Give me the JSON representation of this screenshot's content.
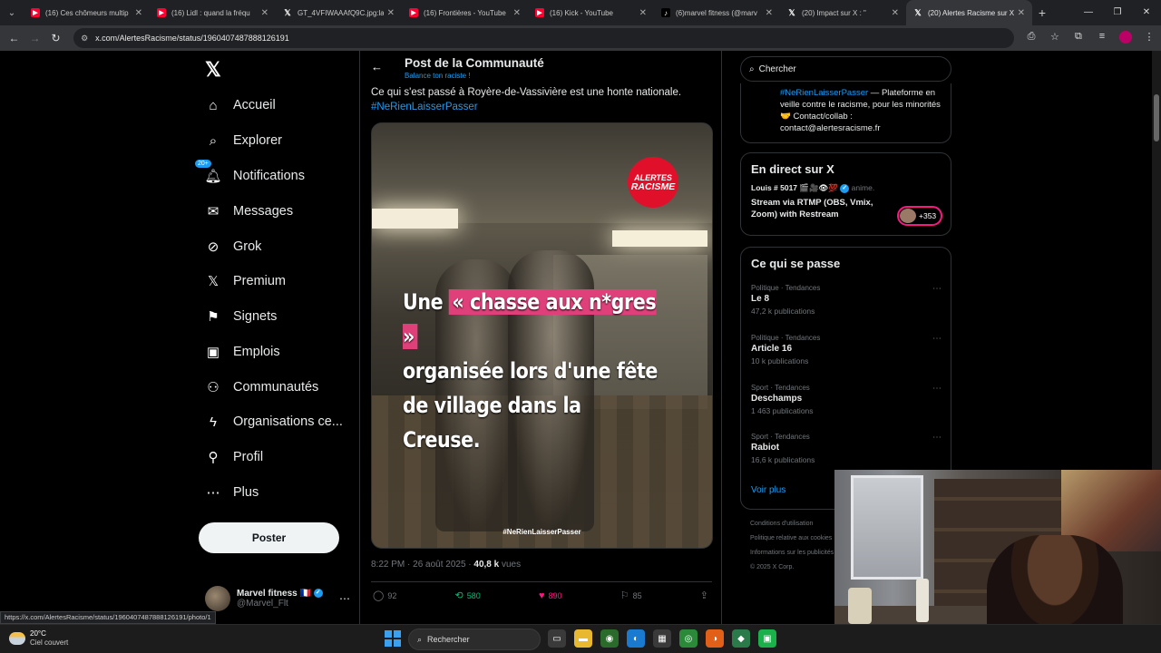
{
  "browser": {
    "tabs": [
      {
        "label": "(16) Ces chômeurs multip",
        "icon": "youtube-icon",
        "active": false
      },
      {
        "label": "(16) Lidl : quand la fréqu",
        "icon": "youtube-icon",
        "active": false
      },
      {
        "label": "GT_4VFIWAAAfQ9C.jpg:la",
        "icon": "x-icon",
        "active": false
      },
      {
        "label": "(16) Frontières - YouTube",
        "icon": "youtube-icon",
        "active": false
      },
      {
        "label": "(16) Kick - YouTube",
        "icon": "youtube-icon",
        "active": false
      },
      {
        "label": "(6)marvel fitness (@marv",
        "icon": "tiktok-icon",
        "active": false
      },
      {
        "label": "(20) Impact sur X : \"",
        "icon": "x-icon",
        "active": false
      },
      {
        "label": "(20) Alertes Racisme sur X",
        "icon": "x-icon",
        "active": true
      }
    ],
    "url": "x.com/AlertesRacisme/status/1960407487888126191",
    "status_link": "https://x.com/AlertesRacisme/status/1960407487888126191/photo/1"
  },
  "nav": {
    "items": [
      {
        "label": "Accueil",
        "icon": "home-icon"
      },
      {
        "label": "Explorer",
        "icon": "search-icon"
      },
      {
        "label": "Notifications",
        "icon": "bell-icon",
        "badge": "20+"
      },
      {
        "label": "Messages",
        "icon": "mail-icon"
      },
      {
        "label": "Grok",
        "icon": "grok-icon"
      },
      {
        "label": "Premium",
        "icon": "x-premium-icon"
      },
      {
        "label": "Signets",
        "icon": "bookmark-icon"
      },
      {
        "label": "Emplois",
        "icon": "briefcase-icon"
      },
      {
        "label": "Communautés",
        "icon": "communities-icon"
      },
      {
        "label": "Organisations ce...",
        "icon": "lightning-icon"
      },
      {
        "label": "Profil",
        "icon": "profile-icon"
      },
      {
        "label": "Plus",
        "icon": "more-circle-icon"
      }
    ],
    "post_button": "Poster",
    "account": {
      "name": "Marvel fitness",
      "flag": "🇫🇷",
      "handle": "@Marvel_Flt"
    }
  },
  "post": {
    "header_title": "Post de la Communauté",
    "header_subtitle": "Balance ton raciste !",
    "text": "Ce qui s'est passé à Royère-de-Vassivière est une honte nationale.",
    "hashtag": "#NeRienLaisserPasser",
    "media": {
      "logo_line1": "ALERTES",
      "logo_line2": "RACISME",
      "overlay_line1_a": "Une ",
      "overlay_line1_highlight": "« chasse aux n*gres »",
      "overlay_line2": "organisée lors d'une fête",
      "overlay_line3": "de village dans la Creuse.",
      "watermark": "#NeRienLaisserPasser"
    },
    "time": "8:22 PM · 26 août 2025 · ",
    "views": "40,8 k",
    "views_label": " vues",
    "replies": "92",
    "reposts": "580",
    "likes": "890",
    "bookmarks": "85",
    "colors": {
      "repost": "#00ba7c",
      "like": "#f91880",
      "link": "#1d9bf0"
    }
  },
  "sidebar": {
    "search_placeholder": "Chercher",
    "bio_tag": "#NeRienLaisserPasser",
    "bio_text": " — Plateforme en veille contre le racisme, pour les minorités 🤝 Contact/collab : contact@alertesracisme.fr",
    "live": {
      "heading": "En direct sur X",
      "user": "Louis # 5017 🎬🎥👁💯",
      "user_meta": " anime.",
      "title": "Stream via RTMP (OBS, Vmix, Zoom) with Restream",
      "count": "+353"
    },
    "trends": {
      "heading": "Ce qui se passe",
      "items": [
        {
          "category": "Politique · Tendances",
          "name": "Le 8",
          "count": "47,2 k publications"
        },
        {
          "category": "Politique · Tendances",
          "name": "Article 16",
          "count": "10 k publications"
        },
        {
          "category": "Sport · Tendances",
          "name": "Deschamps",
          "count": "1 463 publications"
        },
        {
          "category": "Sport · Tendances",
          "name": "Rabiot",
          "count": "16,6 k publications"
        }
      ],
      "see_more": "Voir plus"
    },
    "footer": {
      "line1": "Conditions d'utilisation",
      "line2": "Politique relative aux cookies",
      "line3": "Informations sur les publicités",
      "line4": "© 2025 X Corp."
    }
  },
  "taskbar": {
    "temperature": "20°C",
    "weather": "Ciel couvert",
    "search_label": "Rechercher"
  }
}
